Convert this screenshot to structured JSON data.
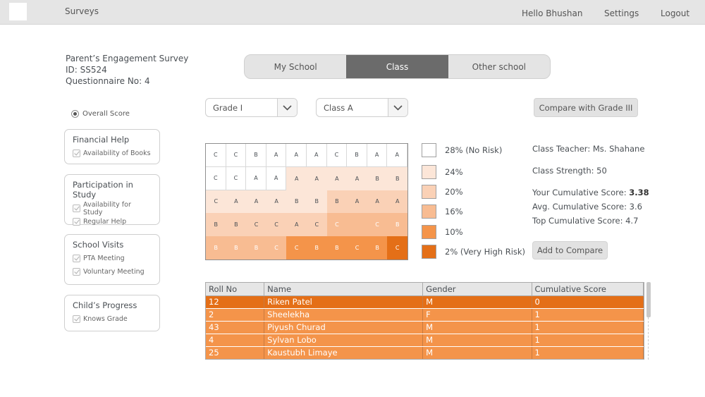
{
  "header": {
    "app_title": "Surveys",
    "greeting": "Hello Bhushan",
    "settings_label": "Settings",
    "logout_label": "Logout"
  },
  "survey": {
    "name": "Parent’s Engagement Survey",
    "id": "ID: SS524",
    "questionnaire": "Questionnaire No: 4"
  },
  "tabs": [
    {
      "label": "My School",
      "active": false
    },
    {
      "label": "Class",
      "active": true
    },
    {
      "label": "Other school",
      "active": false
    }
  ],
  "sidebar": {
    "overall_score_label": "Overall Score",
    "groups": [
      {
        "title": "Financial Help",
        "items": [
          "Availability of Books"
        ]
      },
      {
        "title": "Participation in Study",
        "items": [
          "Availability for Study",
          "Regular Help"
        ]
      },
      {
        "title": "School Visits",
        "items": [
          "PTA Meeting",
          "Voluntary Meeting"
        ]
      },
      {
        "title": "Child’s Progress",
        "items": [
          "Knows Grade"
        ]
      }
    ]
  },
  "filters": {
    "grade_value": "Grade I",
    "class_value": "Class A",
    "compare_button": "Compare with Grade III"
  },
  "heatmap": {
    "colors": [
      "#ffffff",
      "#fce6d8",
      "#fad1b6",
      "#f8bc92",
      "#f4944a",
      "#e46f17"
    ],
    "rows": [
      [
        [
          "C",
          0
        ],
        [
          "C",
          0
        ],
        [
          "B",
          0
        ],
        [
          "A",
          0
        ],
        [
          "A",
          0
        ],
        [
          "A",
          0
        ],
        [
          "C",
          0
        ],
        [
          "B",
          0
        ],
        [
          "A",
          0
        ],
        [
          "A",
          0
        ]
      ],
      [
        [
          "C",
          0
        ],
        [
          "C",
          0
        ],
        [
          "A",
          0
        ],
        [
          "A",
          0
        ],
        [
          "A",
          1
        ],
        [
          "A",
          1
        ],
        [
          "A",
          1
        ],
        [
          "A",
          1
        ],
        [
          "B",
          1
        ],
        [
          "B",
          1
        ]
      ],
      [
        [
          "C",
          1
        ],
        [
          "A",
          1
        ],
        [
          "A",
          1
        ],
        [
          "A",
          1
        ],
        [
          "B",
          1
        ],
        [
          "B",
          1
        ],
        [
          "B",
          2
        ],
        [
          "A",
          2
        ],
        [
          "A",
          2
        ],
        [
          "A",
          2
        ]
      ],
      [
        [
          "B",
          2
        ],
        [
          "B",
          2
        ],
        [
          "C",
          2
        ],
        [
          "C",
          2
        ],
        [
          "A",
          2
        ],
        [
          "C",
          2
        ],
        [
          "C",
          3
        ],
        [
          "",
          3
        ],
        [
          "C",
          3
        ],
        [
          "B",
          3
        ]
      ],
      [
        [
          "B",
          3
        ],
        [
          "B",
          3
        ],
        [
          "B",
          3
        ],
        [
          "C",
          3
        ],
        [
          "C",
          4
        ],
        [
          "B",
          4
        ],
        [
          "B",
          4
        ],
        [
          "C",
          4
        ],
        [
          "B",
          4
        ],
        [
          "C",
          5
        ]
      ]
    ]
  },
  "legend": [
    {
      "label": "28% (No Risk)",
      "color": "#ffffff"
    },
    {
      "label": "24%",
      "color": "#fce6d8"
    },
    {
      "label": "20%",
      "color": "#fad1b6"
    },
    {
      "label": "16%",
      "color": "#f8bc92"
    },
    {
      "label": "10%",
      "color": "#f4944a"
    },
    {
      "label": "2% (Very High Risk)",
      "color": "#e46f17"
    }
  ],
  "class_info": {
    "teacher": "Class Teacher: Ms. Shahane",
    "strength": "Class Strength: 50",
    "your_score_label": "Your Cumulative Score: ",
    "your_score_value": "3.38",
    "avg_score": "Avg. Cumulative Score: 3.6",
    "top_score": "Top Cumulative Score: 4.7",
    "add_to_compare": "Add to Compare"
  },
  "table": {
    "columns": [
      "Roll No",
      "Name",
      "Gender",
      "Cumulative Score"
    ],
    "rows": [
      [
        "12",
        "Riken Patel",
        "M",
        "0"
      ],
      [
        "2",
        "Sheelekha",
        "F",
        "1"
      ],
      [
        "43",
        "Piyush Churad",
        "M",
        "1"
      ],
      [
        "4",
        "Sylvan Lobo",
        "M",
        "1"
      ],
      [
        "25",
        "Kaustubh Limaye",
        "M",
        "1"
      ]
    ]
  }
}
